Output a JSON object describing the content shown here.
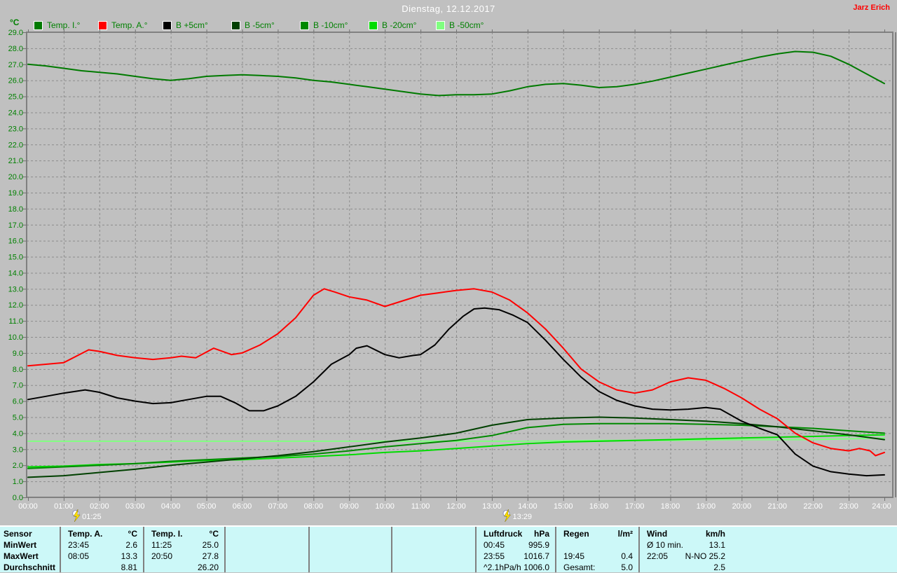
{
  "page": {
    "title": "Dienstag, 12.12.2017",
    "watermark": "Jarz Erich",
    "unit_label": "°C"
  },
  "legend": {
    "items": [
      {
        "id": "temp-i",
        "label": "Temp. I.°",
        "color": "#007a00"
      },
      {
        "id": "temp-a",
        "label": "Temp. A.°",
        "color": "#ff0000"
      },
      {
        "id": "b-plus5",
        "label": "B +5cm°",
        "color": "#000000"
      },
      {
        "id": "b-minus5",
        "label": "B -5cm°",
        "color": "#004000"
      },
      {
        "id": "b-minus10",
        "label": "B -10cm°",
        "color": "#008a00"
      },
      {
        "id": "b-minus20",
        "label": "B -20cm°",
        "color": "#00dc00"
      },
      {
        "id": "b-minus50",
        "label": "B -50cm°",
        "color": "#80ff80"
      }
    ]
  },
  "chart_data": {
    "type": "line",
    "title": "Dienstag, 12.12.2017",
    "y_unit": "°C",
    "ylim": [
      0,
      29
    ],
    "y_step": 1,
    "grid": true,
    "y_ticks": [
      "29.0",
      "28.0",
      "27.0",
      "26.0",
      "25.0",
      "24.0",
      "23.0",
      "22.0",
      "21.0",
      "20.0",
      "19.0",
      "18.0",
      "17.0",
      "16.0",
      "15.0",
      "14.0",
      "13.0",
      "12.0",
      "11.0",
      "10.0",
      "9.0",
      "8.0",
      "7.0",
      "6.0",
      "5.0",
      "4.0",
      "3.0",
      "2.0",
      "1.0",
      "0.0"
    ],
    "x_ticks": [
      "00:00",
      "01:00",
      "02:00",
      "03:00",
      "04:00",
      "05:00",
      "06:00",
      "07:00",
      "08:00",
      "09:00",
      "10:00",
      "11:00",
      "12:00",
      "13:00",
      "14:00",
      "15:00",
      "16:00",
      "17:00",
      "18:00",
      "19:00",
      "20:00",
      "21:00",
      "22:00",
      "23:00",
      "24:00"
    ],
    "markers": [
      {
        "label": "01:25",
        "hour": 1.4167
      },
      {
        "label": "13:29",
        "hour": 13.4833
      }
    ],
    "series": [
      {
        "id": "temp-i",
        "name": "Temp. I.°",
        "color": "#007a00",
        "points": [
          [
            0,
            27.0
          ],
          [
            0.5,
            26.9
          ],
          [
            1,
            26.75
          ],
          [
            1.5,
            26.6
          ],
          [
            2,
            26.5
          ],
          [
            2.5,
            26.4
          ],
          [
            3,
            26.25
          ],
          [
            3.5,
            26.1
          ],
          [
            4,
            26.0
          ],
          [
            4.5,
            26.1
          ],
          [
            5,
            26.25
          ],
          [
            5.5,
            26.3
          ],
          [
            6,
            26.35
          ],
          [
            6.5,
            26.3
          ],
          [
            7,
            26.25
          ],
          [
            7.5,
            26.15
          ],
          [
            8,
            26.0
          ],
          [
            8.5,
            25.9
          ],
          [
            9,
            25.75
          ],
          [
            9.5,
            25.6
          ],
          [
            10,
            25.45
          ],
          [
            10.5,
            25.3
          ],
          [
            11,
            25.15
          ],
          [
            11.5,
            25.05
          ],
          [
            12,
            25.1
          ],
          [
            12.5,
            25.1
          ],
          [
            13,
            25.15
          ],
          [
            13.5,
            25.35
          ],
          [
            14,
            25.6
          ],
          [
            14.5,
            25.75
          ],
          [
            15,
            25.8
          ],
          [
            15.5,
            25.7
          ],
          [
            16,
            25.55
          ],
          [
            16.5,
            25.6
          ],
          [
            17,
            25.75
          ],
          [
            17.5,
            25.95
          ],
          [
            18,
            26.2
          ],
          [
            18.5,
            26.45
          ],
          [
            19,
            26.7
          ],
          [
            19.5,
            26.95
          ],
          [
            20,
            27.2
          ],
          [
            20.5,
            27.45
          ],
          [
            21,
            27.65
          ],
          [
            21.5,
            27.8
          ],
          [
            22,
            27.75
          ],
          [
            22.5,
            27.5
          ],
          [
            23,
            27.0
          ],
          [
            23.5,
            26.4
          ],
          [
            24,
            25.8
          ]
        ]
      },
      {
        "id": "temp-a",
        "name": "Temp. A.°",
        "color": "#ff0000",
        "points": [
          [
            0,
            8.2
          ],
          [
            0.5,
            8.3
          ],
          [
            1,
            8.4
          ],
          [
            1.7,
            9.2
          ],
          [
            2,
            9.1
          ],
          [
            2.5,
            8.85
          ],
          [
            3,
            8.7
          ],
          [
            3.5,
            8.6
          ],
          [
            4,
            8.7
          ],
          [
            4.3,
            8.8
          ],
          [
            4.7,
            8.7
          ],
          [
            5.2,
            9.3
          ],
          [
            5.7,
            8.9
          ],
          [
            6,
            9.0
          ],
          [
            6.5,
            9.5
          ],
          [
            7,
            10.2
          ],
          [
            7.5,
            11.2
          ],
          [
            8,
            12.6
          ],
          [
            8.3,
            13.0
          ],
          [
            8.6,
            12.8
          ],
          [
            9,
            12.5
          ],
          [
            9.5,
            12.3
          ],
          [
            10,
            11.9
          ],
          [
            10.5,
            12.25
          ],
          [
            11,
            12.6
          ],
          [
            11.5,
            12.75
          ],
          [
            12,
            12.9
          ],
          [
            12.5,
            13.0
          ],
          [
            13,
            12.8
          ],
          [
            13.5,
            12.3
          ],
          [
            14,
            11.5
          ],
          [
            14.5,
            10.5
          ],
          [
            15,
            9.3
          ],
          [
            15.5,
            8.0
          ],
          [
            16,
            7.2
          ],
          [
            16.5,
            6.7
          ],
          [
            17,
            6.5
          ],
          [
            17.5,
            6.7
          ],
          [
            18,
            7.2
          ],
          [
            18.5,
            7.45
          ],
          [
            19,
            7.3
          ],
          [
            19.5,
            6.8
          ],
          [
            20,
            6.2
          ],
          [
            20.5,
            5.5
          ],
          [
            21,
            4.9
          ],
          [
            21.5,
            4.0
          ],
          [
            22,
            3.4
          ],
          [
            22.5,
            3.05
          ],
          [
            23,
            2.9
          ],
          [
            23.3,
            3.05
          ],
          [
            23.6,
            2.9
          ],
          [
            23.75,
            2.6
          ],
          [
            24,
            2.8
          ]
        ]
      },
      {
        "id": "b-plus5",
        "name": "B +5cm°",
        "color": "#000000",
        "points": [
          [
            0,
            6.1
          ],
          [
            0.5,
            6.3
          ],
          [
            1,
            6.5
          ],
          [
            1.6,
            6.7
          ],
          [
            2,
            6.55
          ],
          [
            2.5,
            6.2
          ],
          [
            3,
            6.0
          ],
          [
            3.5,
            5.85
          ],
          [
            4,
            5.9
          ],
          [
            4.5,
            6.1
          ],
          [
            5,
            6.3
          ],
          [
            5.4,
            6.3
          ],
          [
            5.8,
            5.9
          ],
          [
            6.2,
            5.4
          ],
          [
            6.6,
            5.4
          ],
          [
            7,
            5.7
          ],
          [
            7.5,
            6.3
          ],
          [
            8,
            7.2
          ],
          [
            8.5,
            8.3
          ],
          [
            9,
            8.9
          ],
          [
            9.2,
            9.3
          ],
          [
            9.5,
            9.45
          ],
          [
            10,
            8.9
          ],
          [
            10.4,
            8.7
          ],
          [
            10.8,
            8.85
          ],
          [
            11,
            8.9
          ],
          [
            11.4,
            9.5
          ],
          [
            11.8,
            10.5
          ],
          [
            12.2,
            11.3
          ],
          [
            12.5,
            11.75
          ],
          [
            12.8,
            11.8
          ],
          [
            13.2,
            11.7
          ],
          [
            13.6,
            11.35
          ],
          [
            14,
            10.9
          ],
          [
            14.5,
            9.8
          ],
          [
            15,
            8.6
          ],
          [
            15.5,
            7.5
          ],
          [
            16,
            6.6
          ],
          [
            16.5,
            6.05
          ],
          [
            17,
            5.7
          ],
          [
            17.5,
            5.5
          ],
          [
            18,
            5.45
          ],
          [
            18.5,
            5.5
          ],
          [
            19,
            5.6
          ],
          [
            19.4,
            5.5
          ],
          [
            20,
            4.75
          ],
          [
            20.5,
            4.3
          ],
          [
            21,
            3.9
          ],
          [
            21.5,
            2.7
          ],
          [
            22,
            1.95
          ],
          [
            22.5,
            1.6
          ],
          [
            23,
            1.45
          ],
          [
            23.5,
            1.35
          ],
          [
            24,
            1.4
          ]
        ]
      },
      {
        "id": "b-minus5",
        "name": "B -5cm°",
        "color": "#004000",
        "points": [
          [
            0,
            1.25
          ],
          [
            1,
            1.35
          ],
          [
            2,
            1.55
          ],
          [
            3,
            1.75
          ],
          [
            4,
            2.0
          ],
          [
            5,
            2.2
          ],
          [
            6,
            2.4
          ],
          [
            7,
            2.6
          ],
          [
            8,
            2.85
          ],
          [
            9,
            3.15
          ],
          [
            10,
            3.45
          ],
          [
            11,
            3.7
          ],
          [
            12,
            4.0
          ],
          [
            13,
            4.5
          ],
          [
            14,
            4.85
          ],
          [
            15,
            4.95
          ],
          [
            16,
            5.0
          ],
          [
            17,
            4.95
          ],
          [
            18,
            4.85
          ],
          [
            19,
            4.75
          ],
          [
            20,
            4.6
          ],
          [
            21,
            4.4
          ],
          [
            22,
            4.15
          ],
          [
            23,
            3.9
          ],
          [
            24,
            3.6
          ]
        ]
      },
      {
        "id": "b-minus10",
        "name": "B -10cm°",
        "color": "#008a00",
        "points": [
          [
            0,
            1.8
          ],
          [
            1,
            1.9
          ],
          [
            2,
            2.0
          ],
          [
            3,
            2.1
          ],
          [
            4,
            2.25
          ],
          [
            5,
            2.35
          ],
          [
            6,
            2.45
          ],
          [
            7,
            2.55
          ],
          [
            8,
            2.7
          ],
          [
            9,
            2.9
          ],
          [
            10,
            3.15
          ],
          [
            11,
            3.35
          ],
          [
            12,
            3.55
          ],
          [
            13,
            3.85
          ],
          [
            14,
            4.35
          ],
          [
            15,
            4.55
          ],
          [
            16,
            4.6
          ],
          [
            17,
            4.6
          ],
          [
            18,
            4.6
          ],
          [
            19,
            4.55
          ],
          [
            20,
            4.5
          ],
          [
            21,
            4.4
          ],
          [
            22,
            4.3
          ],
          [
            23,
            4.15
          ],
          [
            24,
            4.0
          ]
        ]
      },
      {
        "id": "b-minus20",
        "name": "B -20cm°",
        "color": "#00dc00",
        "points": [
          [
            0,
            1.9
          ],
          [
            1,
            1.95
          ],
          [
            2,
            2.05
          ],
          [
            3,
            2.1
          ],
          [
            4,
            2.2
          ],
          [
            5,
            2.3
          ],
          [
            6,
            2.35
          ],
          [
            7,
            2.45
          ],
          [
            8,
            2.55
          ],
          [
            9,
            2.65
          ],
          [
            10,
            2.8
          ],
          [
            11,
            2.9
          ],
          [
            12,
            3.05
          ],
          [
            13,
            3.2
          ],
          [
            14,
            3.35
          ],
          [
            15,
            3.45
          ],
          [
            16,
            3.5
          ],
          [
            17,
            3.55
          ],
          [
            18,
            3.6
          ],
          [
            19,
            3.65
          ],
          [
            20,
            3.7
          ],
          [
            21,
            3.75
          ],
          [
            22,
            3.8
          ],
          [
            23,
            3.85
          ],
          [
            24,
            3.9
          ]
        ]
      },
      {
        "id": "b-minus50",
        "name": "B -50cm°",
        "color": "#80ff80",
        "points": [
          [
            0,
            3.5
          ],
          [
            4,
            3.5
          ],
          [
            8,
            3.5
          ],
          [
            12,
            3.5
          ],
          [
            14,
            3.5
          ],
          [
            16,
            3.55
          ],
          [
            18,
            3.55
          ],
          [
            20,
            3.6
          ],
          [
            22,
            3.6
          ],
          [
            23,
            3.65
          ],
          [
            24,
            3.7
          ]
        ]
      }
    ]
  },
  "table": {
    "row_labels": [
      "Sensor",
      "MinWert",
      "MaxWert",
      "Durchschnitt"
    ],
    "columns": [
      {
        "header": "Temp. A.",
        "unit": "°C",
        "rows": [
          [
            "23:45",
            "2.6"
          ],
          [
            "08:05",
            "13.3"
          ],
          [
            "",
            "8.81"
          ]
        ]
      },
      {
        "header": "Temp. I.",
        "unit": "°C",
        "rows": [
          [
            "11:25",
            "25.0"
          ],
          [
            "20:50",
            "27.8"
          ],
          [
            "",
            "26.20"
          ]
        ]
      },
      {
        "header": "",
        "unit": "",
        "rows": [
          [
            "",
            ""
          ],
          [
            "",
            ""
          ],
          [
            "",
            ""
          ]
        ]
      },
      {
        "header": "",
        "unit": "",
        "rows": [
          [
            "",
            ""
          ],
          [
            "",
            ""
          ],
          [
            "",
            ""
          ]
        ]
      },
      {
        "header": "",
        "unit": "",
        "rows": [
          [
            "",
            ""
          ],
          [
            "",
            ""
          ],
          [
            "",
            ""
          ]
        ]
      },
      {
        "header": "Luftdruck",
        "unit": "hPa",
        "rows": [
          [
            "00:45",
            "995.9"
          ],
          [
            "23:55",
            "1016.7"
          ],
          [
            "^2.1hPa/h",
            "1006.0"
          ]
        ]
      },
      {
        "header": "Regen",
        "unit": "l/m²",
        "rows": [
          [
            "",
            ""
          ],
          [
            "19:45",
            "0.4"
          ],
          [
            "Gesamt:",
            "5.0"
          ]
        ]
      },
      {
        "header": "Wind",
        "unit": "km/h",
        "rows": [
          [
            "Ø 10 min.",
            "13.1"
          ],
          [
            "22:05",
            "N-NO 25.2"
          ],
          [
            "",
            "2.5"
          ]
        ]
      }
    ]
  }
}
